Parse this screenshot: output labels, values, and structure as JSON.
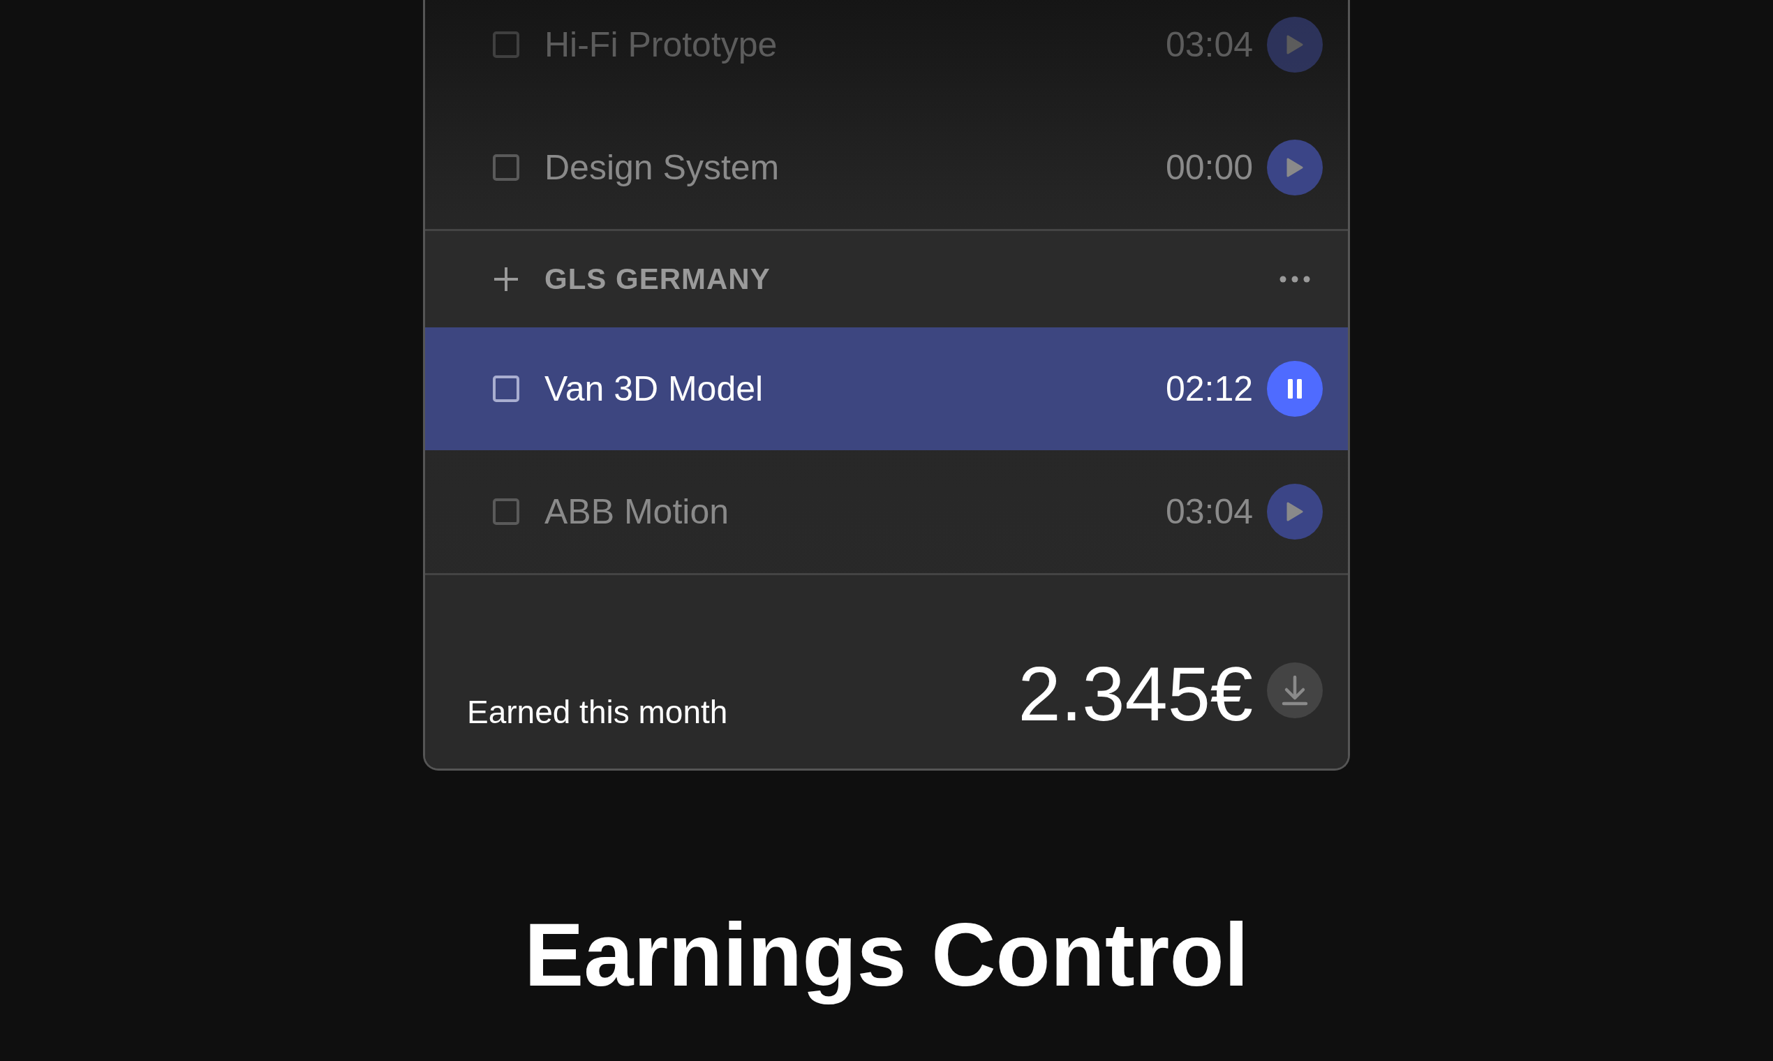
{
  "groups": [
    {
      "tasks": [
        {
          "name": "Hi-Fi Prototype",
          "time": "03:04",
          "checked": false,
          "running": false,
          "faded": true
        },
        {
          "name": "Design System",
          "time": "00:00",
          "checked": false,
          "running": false,
          "faded": false
        }
      ]
    },
    {
      "name": "GLS GERMANY",
      "tasks": [
        {
          "name": "Van 3D Model",
          "time": "02:12",
          "checked": false,
          "running": true,
          "faded": false
        },
        {
          "name": "ABB Motion",
          "time": "03:04",
          "checked": false,
          "running": false,
          "faded": false
        }
      ]
    }
  ],
  "summary": {
    "label": "Earned this month",
    "amount": "2.345€"
  },
  "title": "Earnings Control"
}
